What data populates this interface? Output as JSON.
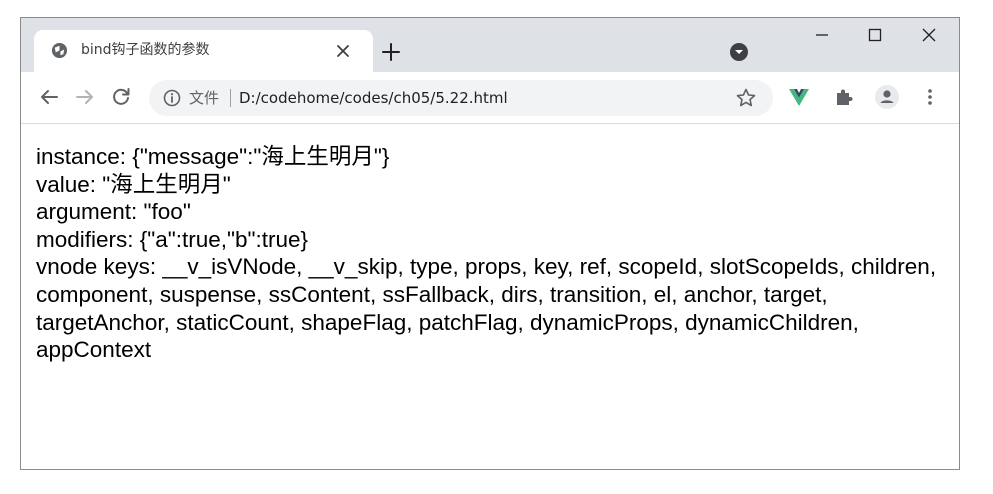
{
  "browser": {
    "tab": {
      "title": "bind钩子函数的参数",
      "favicon": "globe-icon"
    },
    "new_tab_label": "+",
    "address_bar": {
      "info_label": "文件",
      "url": "D:/codehome/codes/ch05/5.22.html"
    },
    "colors": {
      "tabstrip": "#dee1e6",
      "omnibox": "#f1f3f4",
      "vue_green": "#41b883",
      "vue_dark": "#35495e"
    }
  },
  "page": {
    "lines": [
      "instance: {\"message\":\"海上生明月\"}",
      "value: \"海上生明月\"",
      "argument: \"foo\"",
      "modifiers: {\"a\":true,\"b\":true}"
    ],
    "vnode_keys": "vnode keys: __v_isVNode, __v_skip, type, props, key, ref, scopeId, slotScopeIds, children, component, suspense, ssContent, ssFallback, dirs, transition, el, anchor, target, targetAnchor, staticCount, shapeFlag, patchFlag, dynamicProps, dynamicChildren, appContext"
  }
}
